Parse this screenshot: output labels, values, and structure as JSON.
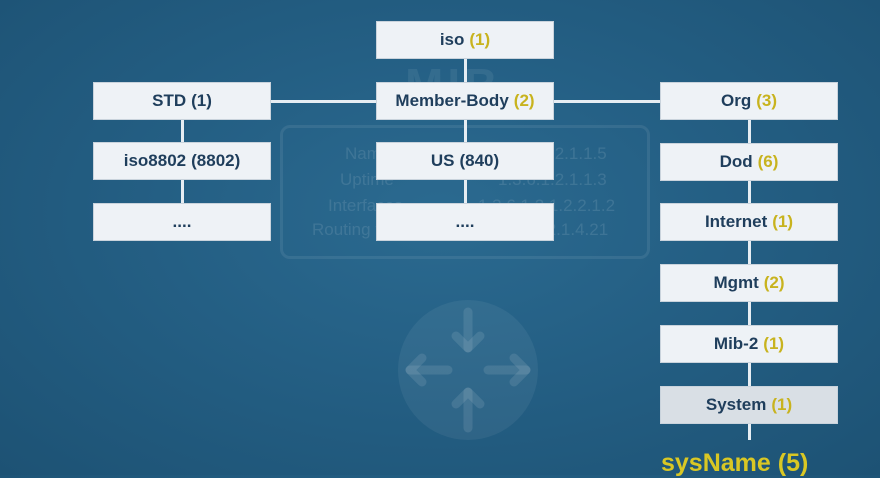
{
  "background_watermark": {
    "title": "MIB",
    "rows": [
      {
        "label": "Name",
        "oid": "1.3.6.1.2.1.1.5"
      },
      {
        "label": "Uptime",
        "oid": "1.3.6.1.2.1.1.3"
      },
      {
        "label": "Interfaces",
        "oid": "1.3.6.1.2.1.2.2.1.2"
      },
      {
        "label": "Routing table",
        "oid": "1.3.6.1.2.1.4.21"
      }
    ]
  },
  "nodes": {
    "iso": {
      "name": "iso",
      "num": "(1)"
    },
    "member_body": {
      "name": "Member-Body",
      "num": "(2)"
    },
    "std": {
      "name": "STD",
      "num": "(1)"
    },
    "iso8802": {
      "name": "iso8802",
      "num": "(8802)"
    },
    "left_ellipsis": {
      "name": "...."
    },
    "us": {
      "name": "US",
      "num": "(840)"
    },
    "mid_ellipsis": {
      "name": "...."
    },
    "org": {
      "name": "Org",
      "num": "(3)"
    },
    "dod": {
      "name": "Dod",
      "num": "(6)"
    },
    "internet": {
      "name": "Internet",
      "num": "(1)"
    },
    "mgmt": {
      "name": "Mgmt",
      "num": "(2)"
    },
    "mib2": {
      "name": "Mib-2",
      "num": "(1)"
    },
    "system": {
      "name": "System",
      "num": "(1)"
    }
  },
  "leaf": {
    "name": "sysName",
    "num": "(5)"
  },
  "colors": {
    "background": "#245f84",
    "node_fill": "#eef2f6",
    "node_text": "#1f3e5c",
    "number_highlight": "#c8b31e",
    "leaf_text": "#d9c724"
  }
}
